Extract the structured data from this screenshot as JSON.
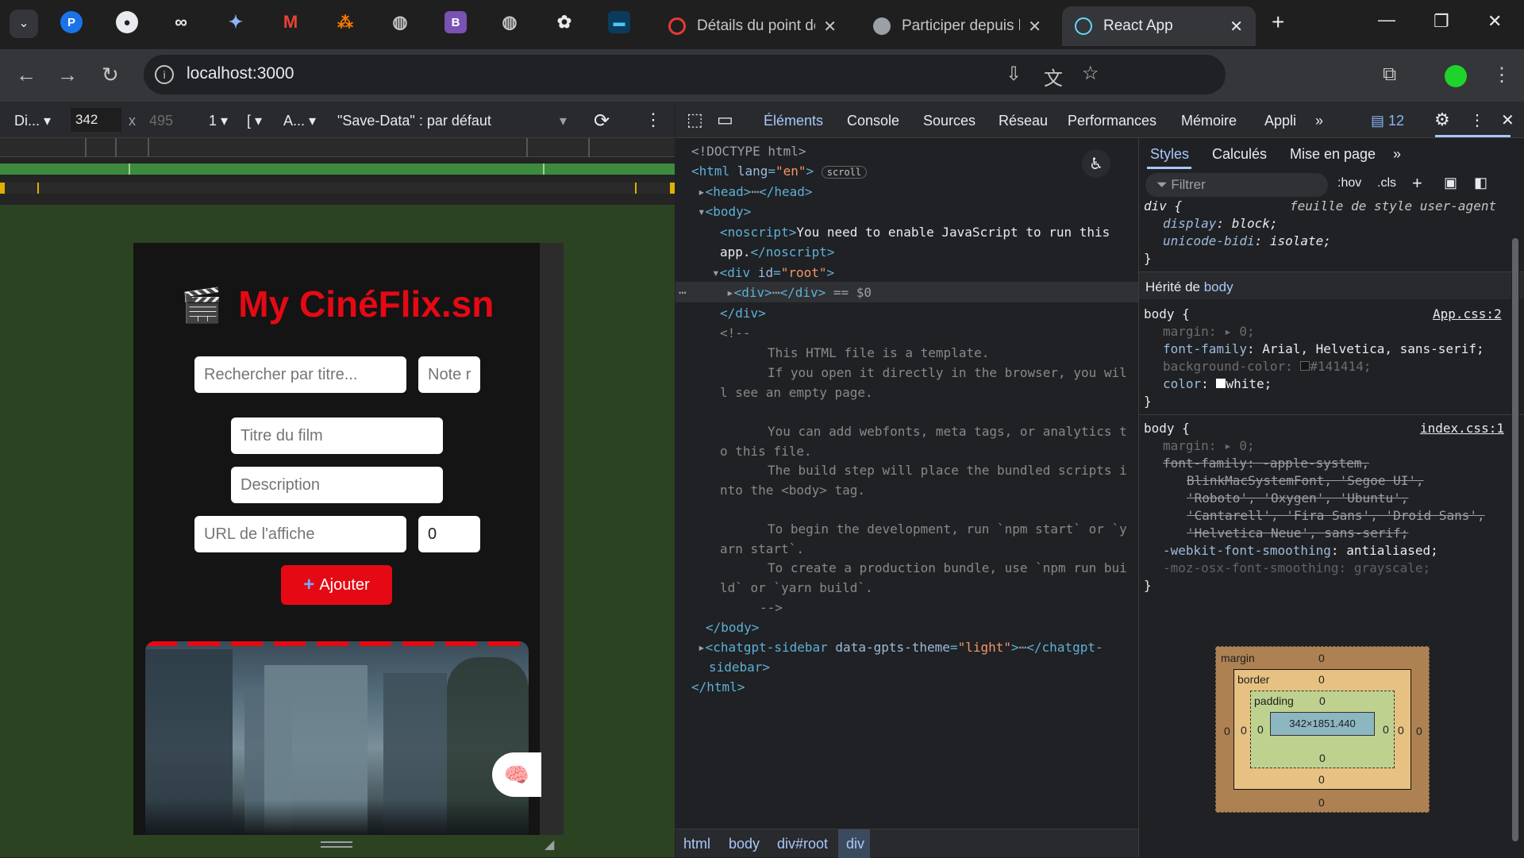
{
  "browser": {
    "tabs": [
      {
        "title": "Détails du point de",
        "active": false
      },
      {
        "title": "Participer depuis l'a",
        "active": false
      },
      {
        "title": "React App",
        "active": true
      }
    ],
    "url": "localhost:3000"
  },
  "viewport_toolbar": {
    "device": "Di...",
    "width": "342",
    "times": "x",
    "height": "495",
    "dpr": "1",
    "bracket": "[",
    "agent": "A...",
    "save_data": "\"Save-Data\" : par défaut"
  },
  "app": {
    "title": "My CinéFlix.sn",
    "search_placeholder": "Rechercher par titre...",
    "rating_filter_placeholder": "Note r",
    "title_placeholder": "Titre du film",
    "description_placeholder": "Description",
    "poster_placeholder": "URL de l'affiche",
    "rating_value": "0",
    "add_label": "Ajouter"
  },
  "devtools": {
    "tabs": [
      "Éléments",
      "Console",
      "Sources",
      "Réseau",
      "Performances",
      "Mémoire",
      "Appli"
    ],
    "issues_count": "12",
    "breadcrumb": [
      "html",
      "body",
      "div#root",
      "div"
    ],
    "styles_tabs": [
      "Styles",
      "Calculés",
      "Mise en page"
    ],
    "filter_placeholder": "Filtrer",
    "hov": ":hov",
    "cls": ".cls",
    "inherited_label": "Hérité de",
    "inherited_from": "body",
    "ua_sheet": "feuille de style user-agent",
    "app_css": "App.css:2",
    "index_css": "index.css:1",
    "dom": {
      "doctype": "<!DOCTYPE html>",
      "scroll_badge": "scroll",
      "noscript_text": "You need to enable JavaScript to run this",
      "noscript_text2": "app.",
      "selected_suffix": "== $0",
      "comment_lines": [
        "This HTML file is a template.",
        "If you open it directly in the browser, you wil",
        "l see an empty page.",
        "You can add webfonts, meta tags, or analytics t",
        "o this file.",
        "The build step will place the bundled scripts i",
        "nto the <body> tag.",
        "To begin the development, run `npm start` or `y",
        "arn start`.",
        "To create a production bundle, use `npm run bui",
        "ld` or `yarn build`."
      ],
      "sidebar_tag": "chatgpt-sidebar",
      "sidebar_attr": "data-gpts-theme",
      "sidebar_val": "\"light\""
    },
    "box_model": {
      "margin_label": "margin",
      "border_label": "border",
      "padding_label": "padding",
      "zero": "0",
      "content": "342×1851.440"
    }
  }
}
